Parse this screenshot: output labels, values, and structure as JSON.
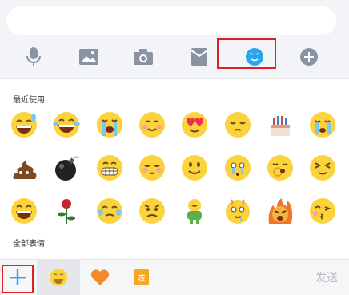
{
  "panel": {
    "recent_label": "最近使用",
    "all_label": "全部表情",
    "send_label": "发送",
    "recommend_badge": "荐"
  },
  "toolbar": {
    "items": [
      {
        "name": "voice",
        "icon": "microphone-icon"
      },
      {
        "name": "image",
        "icon": "image-icon"
      },
      {
        "name": "camera",
        "icon": "camera-icon"
      },
      {
        "name": "red-packet",
        "icon": "red-packet-icon"
      },
      {
        "name": "emoji",
        "icon": "emoji-face-icon",
        "selected": true
      },
      {
        "name": "more",
        "icon": "plus-circle-icon"
      }
    ]
  },
  "emoji_rows": [
    [
      "grin-sweat",
      "laugh-tears",
      "crying-loud",
      "blush-smile",
      "heart-eyes",
      "relieved",
      "birthday-cake",
      "crying-face"
    ],
    [
      "poop",
      "bomb",
      "toothy-grin",
      "shy",
      "smile",
      "teary-scared",
      "yawn",
      "squint-happy"
    ],
    [
      "big-grin",
      "rose",
      "tearful-laugh",
      "worried",
      "green-figure",
      "confused-drool",
      "furious-fire",
      "wink-kiss"
    ]
  ],
  "colors": {
    "accent_blue": "#2aa4ee",
    "highlight_red": "#e02020",
    "emoji_yellow": "#fcd23d",
    "heart_orange": "#f08a2b"
  }
}
